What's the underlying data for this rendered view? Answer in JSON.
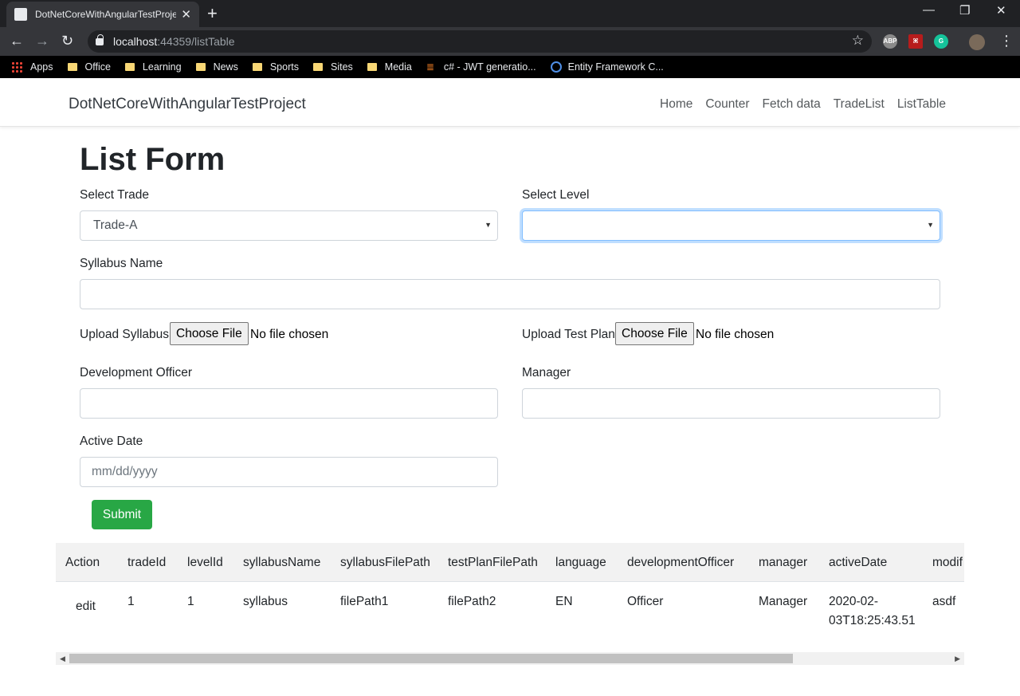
{
  "browser": {
    "tab_title": "DotNetCoreWithAngularTestProject",
    "url_host": "localhost",
    "url_path": ":44359/listTable",
    "bookmarks": [
      "Apps",
      "Office",
      "Learning",
      "News",
      "Sports",
      "Sites",
      "Media",
      "c# - JWT generatio...",
      "Entity Framework C..."
    ]
  },
  "navbar": {
    "brand": "DotNetCoreWithAngularTestProject",
    "links": [
      "Home",
      "Counter",
      "Fetch data",
      "TradeList",
      "ListTable"
    ]
  },
  "form": {
    "title": "List Form",
    "select_trade_label": "Select Trade",
    "select_trade_value": "Trade-A",
    "select_level_label": "Select Level",
    "select_level_value": "",
    "syllabus_name_label": "Syllabus Name",
    "syllabus_name_value": "",
    "upload_syllabus_label": "Upload Syllabus",
    "upload_test_plan_label": "Upload Test Plan",
    "choose_file_label": "Choose File",
    "no_file_text": "No file chosen",
    "development_officer_label": "Development Officer",
    "manager_label": "Manager",
    "active_date_label": "Active Date",
    "active_date_placeholder": "mm/dd/yyyy",
    "submit_label": "Submit"
  },
  "table": {
    "headers": [
      "Action",
      "tradeId",
      "levelId",
      "syllabusName",
      "syllabusFilePath",
      "testPlanFilePath",
      "language",
      "developmentOfficer",
      "manager",
      "activeDate",
      "modif"
    ],
    "rows": [
      {
        "action": "edit",
        "tradeId": "1",
        "levelId": "1",
        "syllabusName": "syllabus",
        "syllabusFilePath": "filePath1",
        "testPlanFilePath": "filePath2",
        "language": "EN",
        "developmentOfficer": "Officer",
        "manager": "Manager",
        "activeDate_line1": "2020-02-",
        "activeDate_line2": "03T18:25:43.51",
        "modif": "asdf"
      }
    ]
  },
  "scrollbar_position": 0.0
}
